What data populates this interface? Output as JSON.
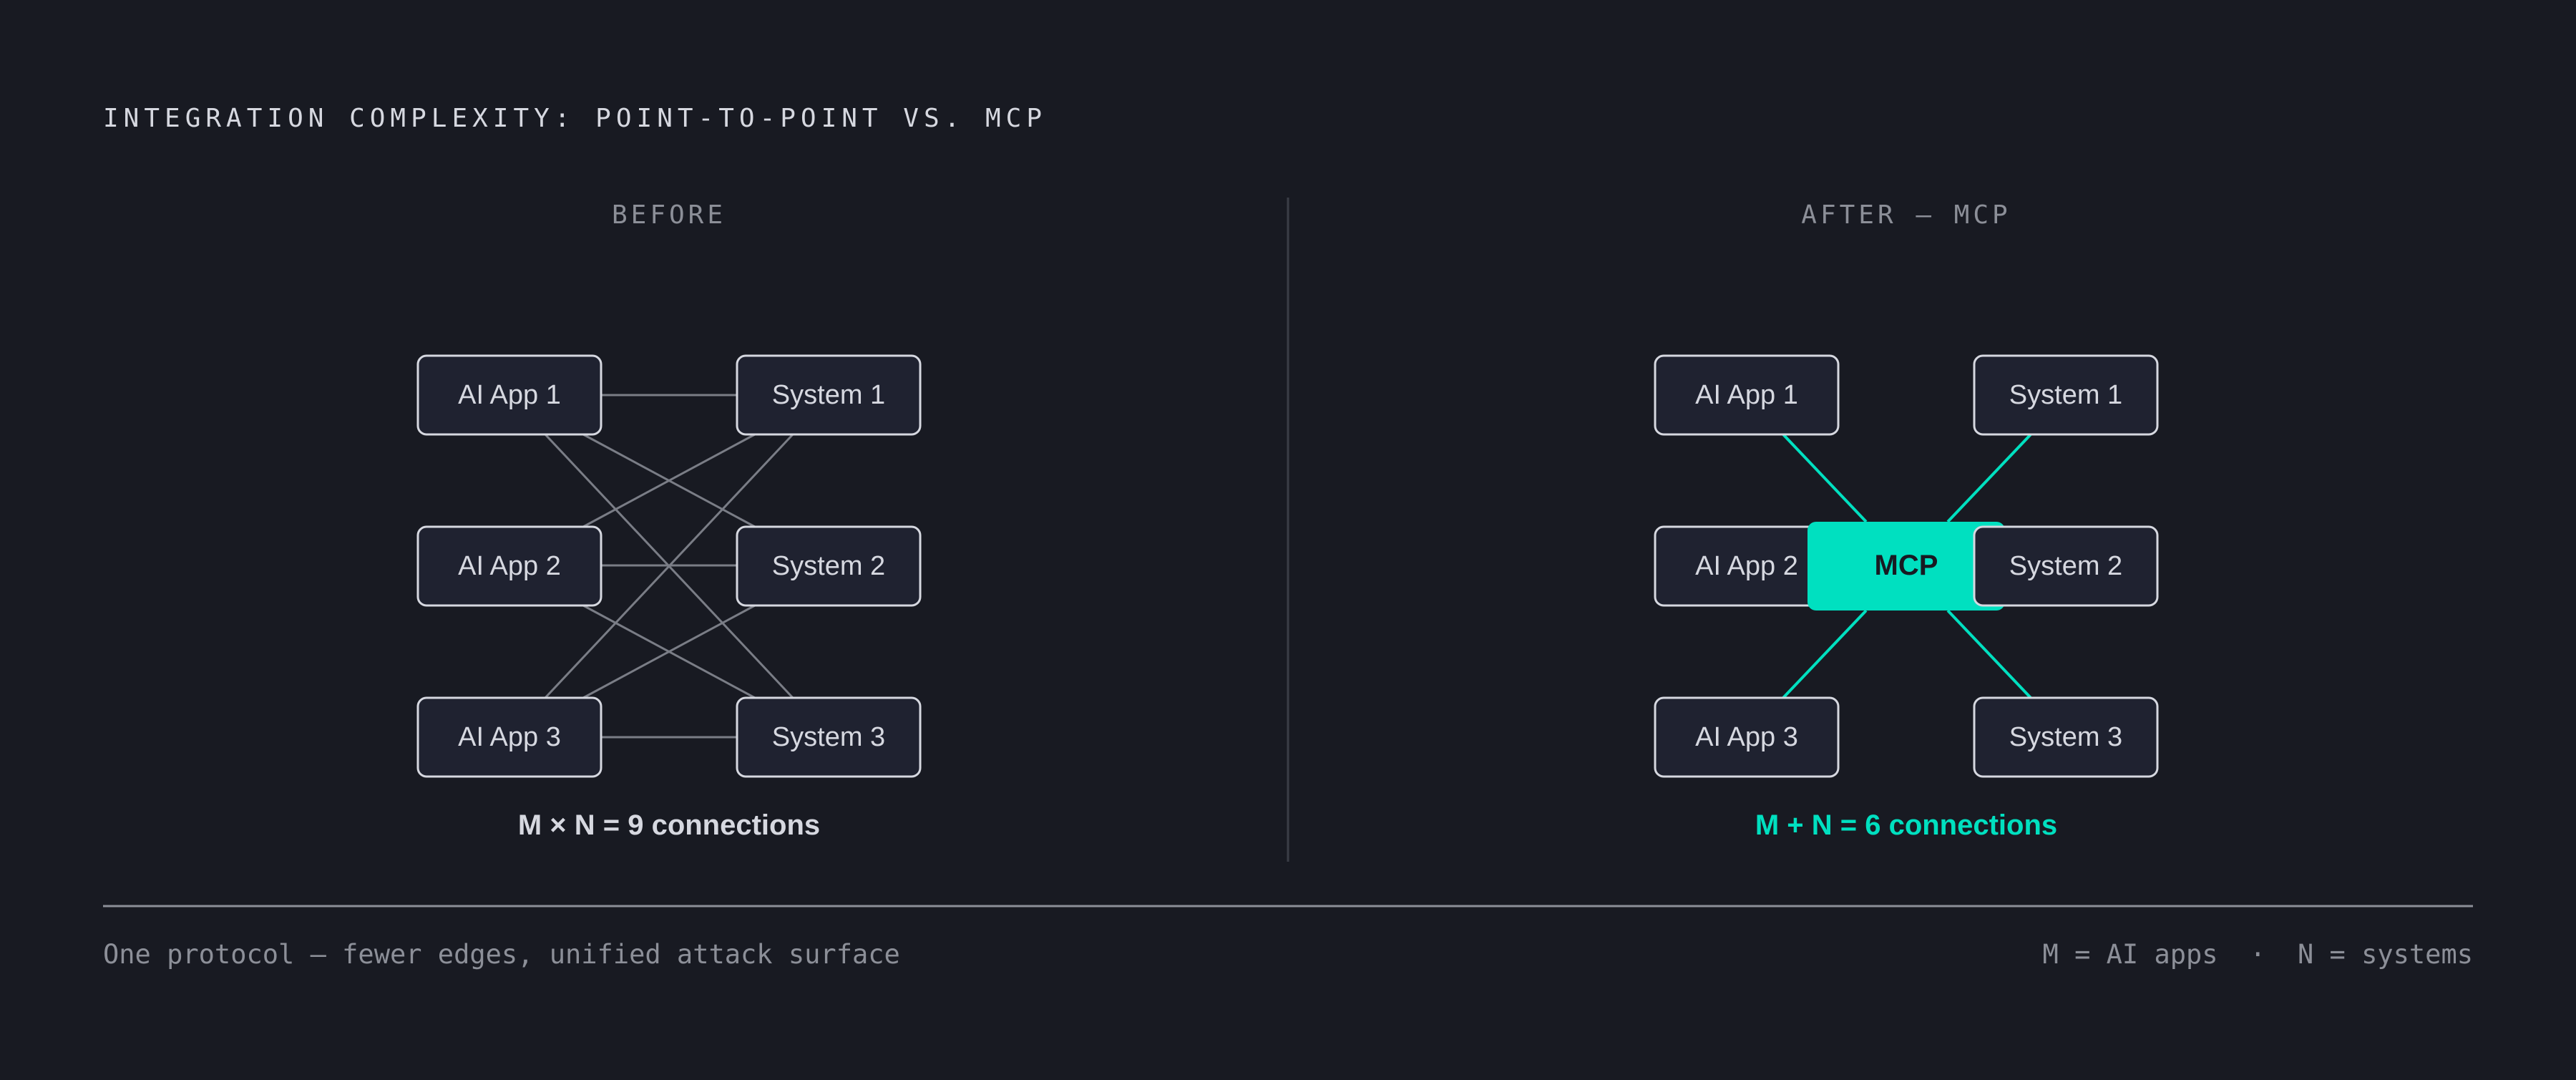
{
  "header": {
    "title": "INTEGRATION COMPLEXITY: POINT-TO-POINT VS. MCP"
  },
  "before": {
    "label": "BEFORE",
    "apps": [
      "AI App 1",
      "AI App 2",
      "AI App 3"
    ],
    "systems": [
      "System 1",
      "System 2",
      "System 3"
    ],
    "caption": "M × N = 9 connections"
  },
  "after": {
    "label": "AFTER — MCP",
    "hub": "MCP",
    "apps": [
      "AI App 1",
      "AI App 2",
      "AI App 3"
    ],
    "systems": [
      "System 1",
      "System 2",
      "System 3"
    ],
    "caption": "M + N = 6 connections"
  },
  "footer": {
    "note": "One protocol — fewer edges, unified attack surface",
    "legend": "M = AI apps  ·  N = systems"
  },
  "colors": {
    "background": "#181a22",
    "node_fill": "#1f2230",
    "node_stroke": "#d6d8e0",
    "edge": "#7a7d86",
    "accent": "#00e0c0",
    "text": "#d6d8e0",
    "muted": "#8c8f98"
  }
}
